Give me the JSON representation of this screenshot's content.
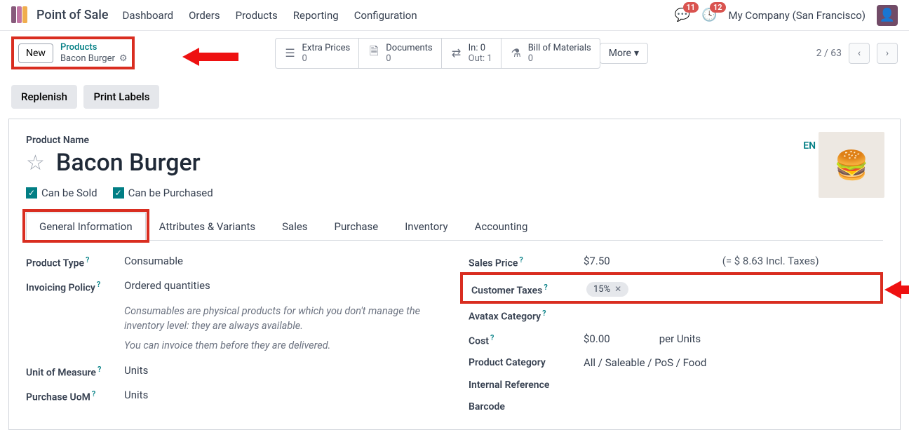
{
  "app_name": "Point of Sale",
  "nav": [
    "Dashboard",
    "Orders",
    "Products",
    "Reporting",
    "Configuration"
  ],
  "badges": {
    "messages": "11",
    "activities": "12"
  },
  "company": "My Company (San Francisco)",
  "new_label": "New",
  "breadcrumb": {
    "parent": "Products",
    "current": "Bacon Burger"
  },
  "smart": {
    "extra_prices": {
      "label": "Extra Prices",
      "value": "0"
    },
    "documents": {
      "label": "Documents",
      "value": "0"
    },
    "in": {
      "label": "In:",
      "value": "0"
    },
    "out": {
      "label": "Out:",
      "value": "1"
    },
    "bom": {
      "label": "Bill of Materials",
      "value": "0"
    },
    "more": "More"
  },
  "pager": "2 / 63",
  "actions": {
    "replenish": "Replenish",
    "print_labels": "Print Labels"
  },
  "product": {
    "name_label": "Product Name",
    "name": "Bacon Burger",
    "lang": "EN",
    "can_sold": "Can be Sold",
    "can_purchased": "Can be Purchased"
  },
  "tabs": [
    "General Information",
    "Attributes & Variants",
    "Sales",
    "Purchase",
    "Inventory",
    "Accounting"
  ],
  "left": {
    "product_type": {
      "label": "Product Type",
      "value": "Consumable"
    },
    "invoicing_policy": {
      "label": "Invoicing Policy",
      "value": "Ordered quantities"
    },
    "help1": "Consumables are physical products for which you don't manage the inventory level: they are always available.",
    "help2": "You can invoice them before they are delivered.",
    "uom": {
      "label": "Unit of Measure",
      "value": "Units"
    },
    "purchase_uom": {
      "label": "Purchase UoM",
      "value": "Units"
    }
  },
  "right": {
    "sales_price": {
      "label": "Sales Price",
      "value": "$7.50",
      "incl": "(= $ 8.63 Incl. Taxes)"
    },
    "customer_taxes": {
      "label": "Customer Taxes",
      "tag": "15%"
    },
    "avatax": {
      "label": "Avatax Category"
    },
    "cost": {
      "label": "Cost",
      "value": "$0.00",
      "per": "per Units"
    },
    "category": {
      "label": "Product Category",
      "value": "All / Saleable / PoS / Food"
    },
    "internal_ref": {
      "label": "Internal Reference"
    },
    "barcode": {
      "label": "Barcode"
    }
  }
}
